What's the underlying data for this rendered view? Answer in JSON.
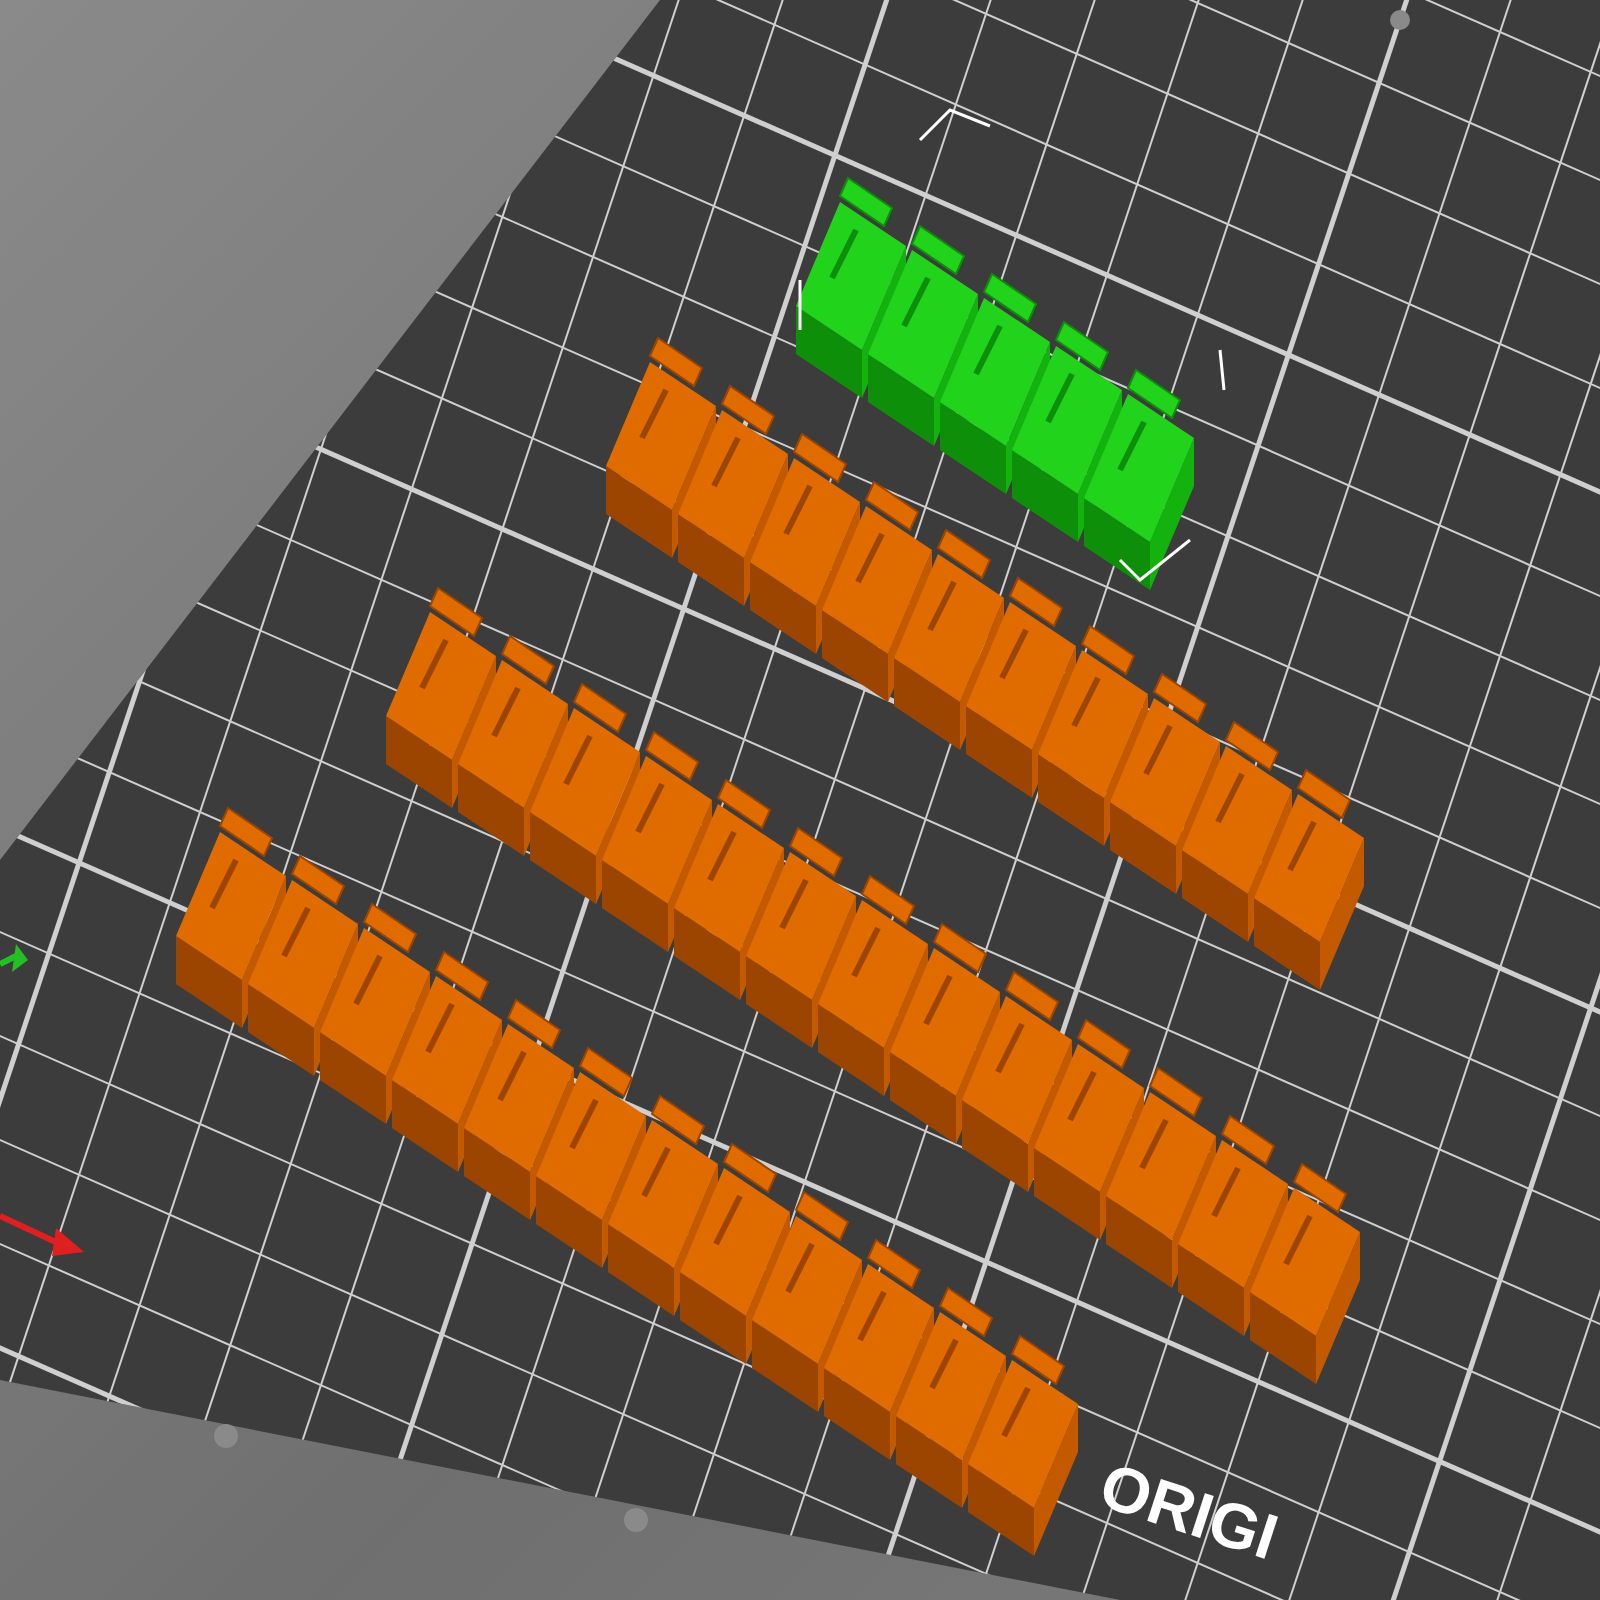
{
  "viewport": {
    "bed_label": "ORIGI",
    "objects": [
      {
        "selected": true
      },
      {
        "selected": false
      },
      {
        "selected": false
      },
      {
        "selected": false
      }
    ]
  }
}
